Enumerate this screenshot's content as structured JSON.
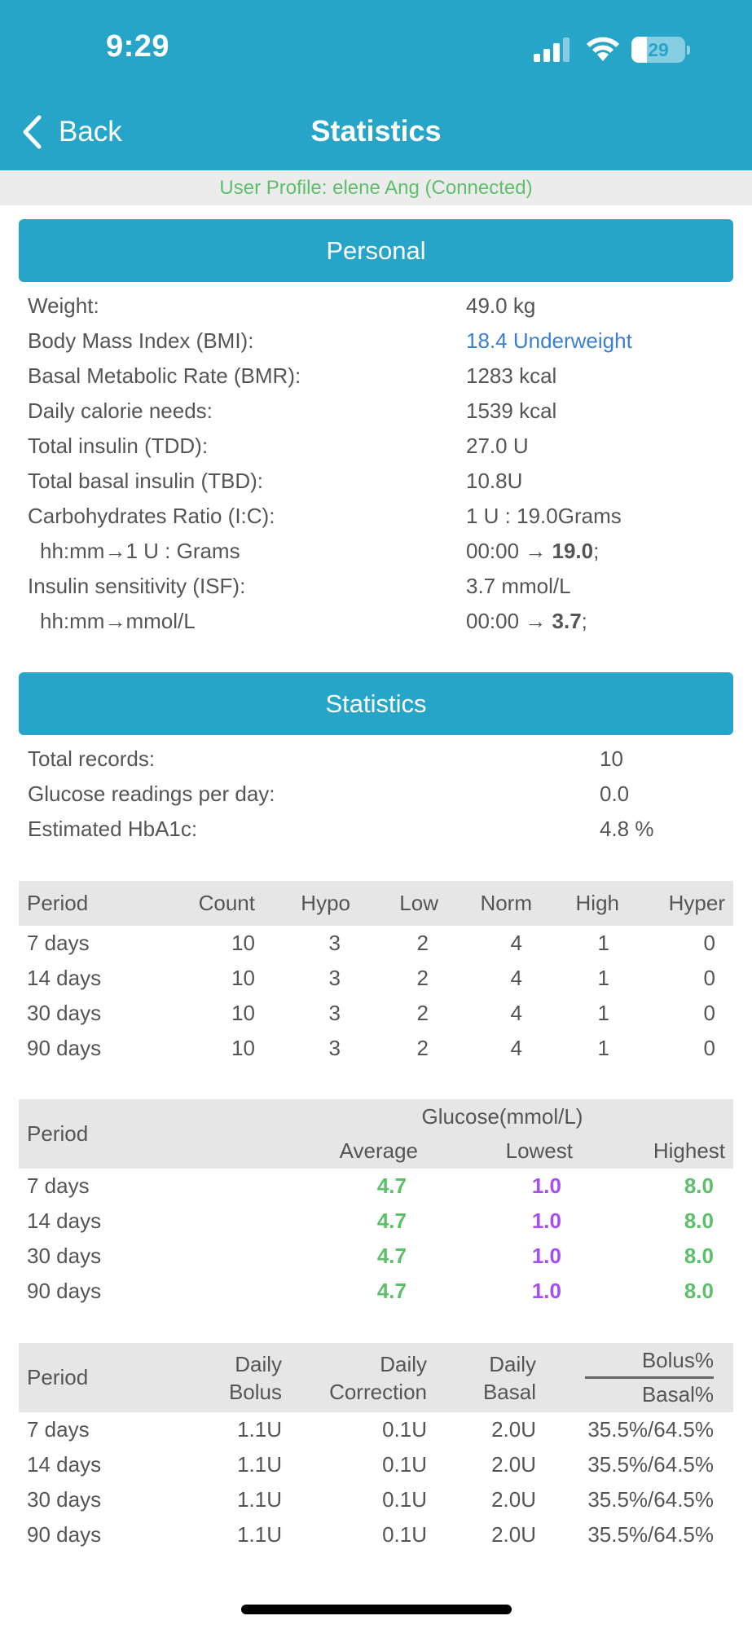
{
  "status_bar": {
    "time": "9:29",
    "battery": "29",
    "battery_level": 0.29
  },
  "nav": {
    "back_label": "Back",
    "title": "Statistics"
  },
  "profile_text": "User Profile: elene Ang (Connected)",
  "colors": {
    "accent": "#26a5c8",
    "green": "#5cbf6a",
    "purple": "#a54ef5",
    "link": "#3a7fd5"
  },
  "personal": {
    "header": "Personal",
    "rows": [
      {
        "label": "Weight:",
        "value": "49.0 kg"
      },
      {
        "label": "Body Mass Index (BMI):",
        "value": "18.4 Underweight"
      },
      {
        "label": "Basal Metabolic Rate (BMR):",
        "value": "1283 kcal"
      },
      {
        "label": "Daily calorie needs:",
        "value": "1539 kcal"
      },
      {
        "label": "Total insulin (TDD):",
        "value": "27.0 U"
      },
      {
        "label": "Total basal insulin (TBD):",
        "value": "10.8U"
      },
      {
        "label": "Carbohydrates Ratio (I:C):",
        "value": "1 U : 19.0Grams"
      },
      {
        "label": "hh:mm→1 U : Grams",
        "value_prefix": "00:00 → ",
        "value_bold": "19.0",
        "value_suffix": ";"
      },
      {
        "label": "Insulin sensitivity (ISF):",
        "value": "3.7 mmol/L"
      },
      {
        "label": "hh:mm→mmol/L",
        "value_prefix": "00:00 → ",
        "value_bold": "3.7",
        "value_suffix": ";"
      }
    ]
  },
  "statistics": {
    "header": "Statistics",
    "rows": [
      {
        "label": "Total records:",
        "value": "10"
      },
      {
        "label": "Glucose readings per day:",
        "value": "0.0"
      },
      {
        "label": "Estimated HbA1c:",
        "value": "4.8 %"
      }
    ]
  },
  "count_table": {
    "headers": [
      "Period",
      "Count",
      "Hypo",
      "Low",
      "Norm",
      "High",
      "Hyper"
    ],
    "rows": [
      [
        "7 days",
        "10",
        "3",
        "2",
        "4",
        "1",
        "0"
      ],
      [
        "14 days",
        "10",
        "3",
        "2",
        "4",
        "1",
        "0"
      ],
      [
        "30 days",
        "10",
        "3",
        "2",
        "4",
        "1",
        "0"
      ],
      [
        "90 days",
        "10",
        "3",
        "2",
        "4",
        "1",
        "0"
      ]
    ]
  },
  "glucose_table": {
    "period_header": "Period",
    "group_header": "Glucose(mmol/L)",
    "sub_headers": [
      "Average",
      "Lowest",
      "Highest"
    ],
    "rows": [
      [
        "7 days",
        "4.7",
        "1.0",
        "8.0"
      ],
      [
        "14 days",
        "4.7",
        "1.0",
        "8.0"
      ],
      [
        "30 days",
        "4.7",
        "1.0",
        "8.0"
      ],
      [
        "90 days",
        "4.7",
        "1.0",
        "8.0"
      ]
    ]
  },
  "insulin_table": {
    "headers": [
      "Period",
      "Daily Bolus",
      "Daily Correction",
      "Daily Basal"
    ],
    "header_lines": [
      [
        "Daily",
        "Bolus"
      ],
      [
        "Daily",
        "Correction"
      ],
      [
        "Daily",
        "Basal"
      ]
    ],
    "ratio_top": "Bolus%",
    "ratio_bottom": "Basal%",
    "rows": [
      [
        "7 days",
        "1.1U",
        "0.1U",
        "2.0U",
        "35.5%/64.5%"
      ],
      [
        "14 days",
        "1.1U",
        "0.1U",
        "2.0U",
        "35.5%/64.5%"
      ],
      [
        "30 days",
        "1.1U",
        "0.1U",
        "2.0U",
        "35.5%/64.5%"
      ],
      [
        "90 days",
        "1.1U",
        "0.1U",
        "2.0U",
        "35.5%/64.5%"
      ]
    ]
  }
}
